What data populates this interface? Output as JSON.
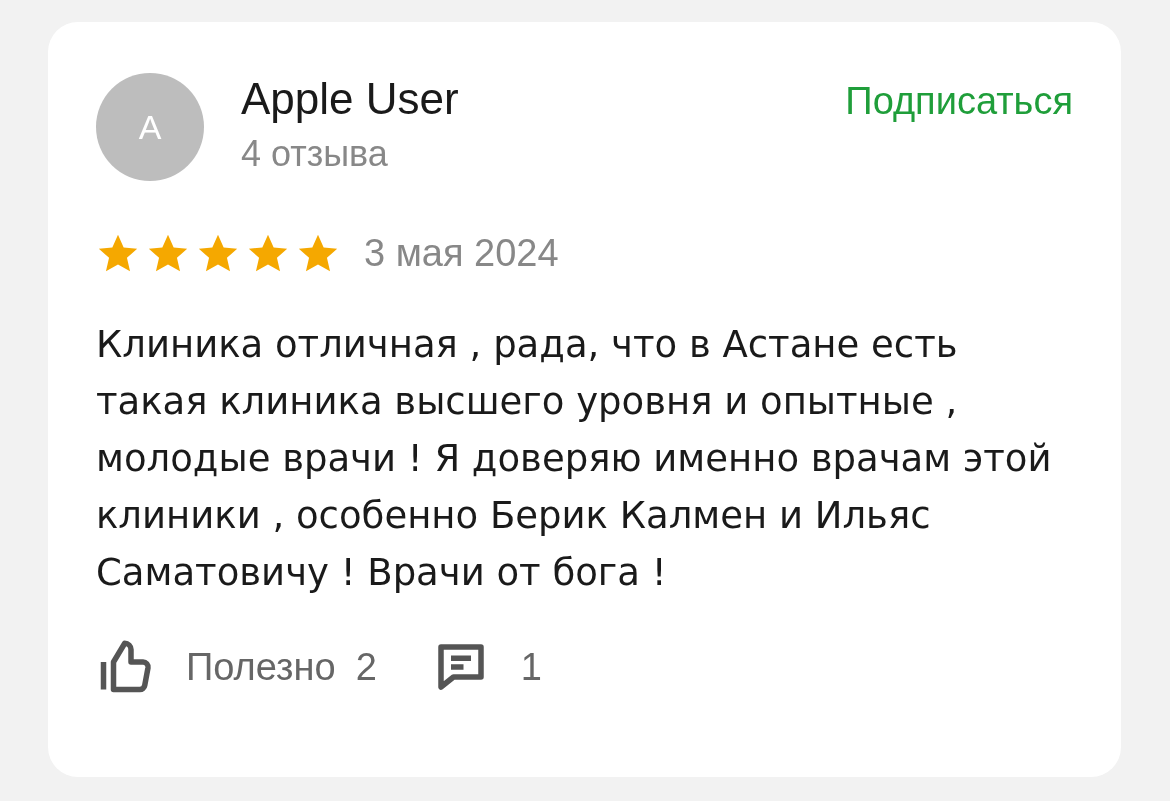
{
  "review": {
    "avatar_letter": "A",
    "author": "Apple User",
    "reviews_count": "4 отзыва",
    "subscribe": "Подписаться",
    "stars": 5,
    "date": "3 мая 2024",
    "text": "Клиника отличная , рада, что в Астане есть такая клиника высшего уровня и опытные , молодые врачи ! Я доверяю именно врачам этой клиники , особенно Берик Калмен и Ильяс Саматовичу ! Врачи от бога !",
    "helpful": "Полезно",
    "helpful_count": "2",
    "comments_count": "1"
  }
}
